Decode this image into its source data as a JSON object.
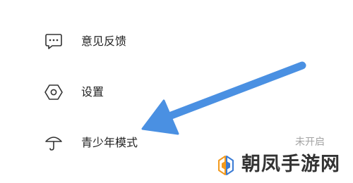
{
  "menu": {
    "feedback": {
      "label": "意见反馈",
      "icon": "chat-bubble-icon"
    },
    "settings": {
      "label": "设置",
      "icon": "hexagon-settings-icon"
    },
    "teen_mode": {
      "label": "青少年模式",
      "icon": "umbrella-icon",
      "status": "未开启"
    }
  },
  "overlay": {
    "arrow_color": "#4a90e2"
  },
  "watermark": {
    "text": "朝凤手游网"
  },
  "colors": {
    "label_text": "#1f1f1f",
    "status_text": "#a3a3a3",
    "icon_stroke": "#333333"
  }
}
